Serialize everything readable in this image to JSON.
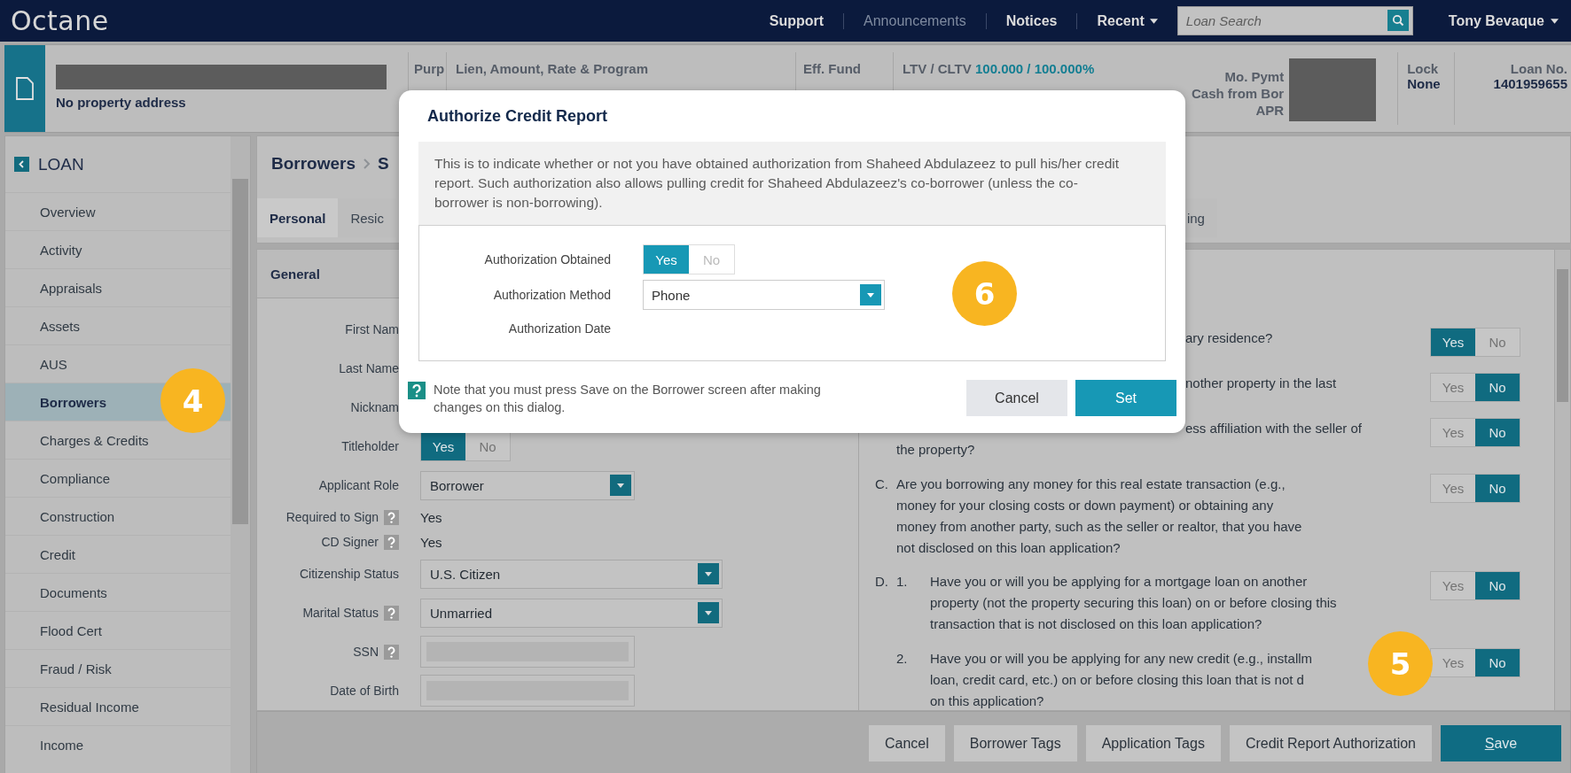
{
  "header": {
    "logo": "Octane",
    "nav": [
      {
        "label": "Support",
        "kind": "link",
        "disabled": false
      },
      {
        "label": "Announcements",
        "kind": "link",
        "disabled": true
      },
      {
        "label": "Notices",
        "kind": "link",
        "disabled": false
      },
      {
        "label": "Recent",
        "kind": "menu",
        "disabled": false
      }
    ],
    "search": {
      "placeholder": "Loan Search"
    },
    "user": {
      "name": "Tony Bevaque"
    }
  },
  "loan_bar": {
    "address": "No property address",
    "purpose_label": "Purp",
    "lien_label": "Lien, Amount, Rate & Program",
    "eff_fund_label": "Eff. Fund",
    "ltv_label": "LTV / CLTV",
    "ltv_value": "100.000 / 100.000%",
    "payment_labels": [
      "Mo. Pymt",
      "Cash from Bor",
      "APR"
    ],
    "lock_label": "Lock",
    "lock_value": "None",
    "loan_no_label": "Loan No.",
    "loan_no_value": "1401959655"
  },
  "sidebar": {
    "title": "LOAN",
    "callout": "4",
    "items": [
      {
        "label": "Overview",
        "selected": false
      },
      {
        "label": "Activity",
        "selected": false
      },
      {
        "label": "Appraisals",
        "selected": false
      },
      {
        "label": "Assets",
        "selected": false
      },
      {
        "label": "AUS",
        "selected": false
      },
      {
        "label": "Borrowers",
        "selected": true
      },
      {
        "label": "Charges & Credits",
        "selected": false
      },
      {
        "label": "Compliance",
        "selected": false
      },
      {
        "label": "Construction",
        "selected": false
      },
      {
        "label": "Credit",
        "selected": false
      },
      {
        "label": "Documents",
        "selected": false
      },
      {
        "label": "Flood Cert",
        "selected": false
      },
      {
        "label": "Fraud / Risk",
        "selected": false
      },
      {
        "label": "Residual Income",
        "selected": false
      },
      {
        "label": "Income",
        "selected": false
      }
    ]
  },
  "page": {
    "breadcrumb": [
      "Borrowers",
      "S"
    ],
    "tabs": [
      {
        "label": "Personal",
        "selected": true
      },
      {
        "label": "Resic",
        "selected": false
      },
      {
        "label": "ing",
        "selected": false
      }
    ]
  },
  "general": {
    "title": "General",
    "fields": [
      {
        "kind": "label",
        "label": "First Nam"
      },
      {
        "kind": "label",
        "label": "Last Name"
      },
      {
        "kind": "label",
        "label": "Nicknam"
      },
      {
        "kind": "toggle",
        "label": "Titleholder",
        "options": [
          {
            "label": "Yes",
            "selected": true
          },
          {
            "label": "No",
            "selected": false
          }
        ]
      },
      {
        "kind": "select",
        "label": "Applicant Role",
        "value": "Borrower"
      },
      {
        "kind": "text",
        "label": "Required to Sign",
        "help": true,
        "value": "Yes"
      },
      {
        "kind": "text",
        "label": "CD Signer",
        "help": true,
        "value": "Yes"
      },
      {
        "kind": "long-select",
        "label": "Citizenship Status",
        "value": "U.S. Citizen"
      },
      {
        "kind": "long-select",
        "label": "Marital Status",
        "help": true,
        "value": "Unmarried"
      },
      {
        "kind": "masked",
        "label": "SSN",
        "help": true
      },
      {
        "kind": "masked",
        "label": "Date of Birth"
      }
    ]
  },
  "questions": {
    "callout": "5",
    "items": [
      {
        "lines": [
          "ary residence?"
        ],
        "options": [
          {
            "label": "Yes",
            "selected": true
          },
          {
            "label": "No",
            "selected": false
          }
        ]
      },
      {
        "lines": [
          "nother property in the last"
        ],
        "options": [
          {
            "label": "Yes",
            "selected": false
          },
          {
            "label": "No",
            "selected": true
          }
        ]
      },
      {
        "lines": [
          "ess affiliation with the seller of",
          "the property?"
        ],
        "options": [
          {
            "label": "Yes",
            "selected": false
          },
          {
            "label": "No",
            "selected": true
          }
        ]
      },
      {
        "letter": "C.",
        "lines": [
          "Are you borrowing any money for this real estate transaction (e.g.,",
          "money for your closing costs or down payment) or obtaining any",
          "money from another party, such as the seller or realtor, that you have",
          "not disclosed on this loan application?"
        ],
        "options": [
          {
            "label": "Yes",
            "selected": false
          },
          {
            "label": "No",
            "selected": true
          }
        ]
      },
      {
        "letter": "D.",
        "number": "1.",
        "lines": [
          "Have you or will you be applying for a mortgage loan on another",
          "property (not the property securing this loan) on or before closing this",
          "transaction that is not disclosed on this loan application?"
        ],
        "options": [
          {
            "label": "Yes",
            "selected": false
          },
          {
            "label": "No",
            "selected": true
          }
        ]
      },
      {
        "number": "2.",
        "lines": [
          "Have you or will you be applying for any new credit (e.g., installm",
          "loan, credit card, etc.) on or before closing this loan that is not d",
          "on this application?"
        ],
        "options": [
          {
            "label": "Yes",
            "selected": false
          },
          {
            "label": "No",
            "selected": true
          }
        ]
      }
    ]
  },
  "footer_buttons": [
    {
      "label": "Cancel",
      "primary": false
    },
    {
      "label": "Borrower Tags",
      "primary": false
    },
    {
      "label": "Application Tags",
      "primary": false
    },
    {
      "label": "Credit Report Authorization",
      "primary": false
    },
    {
      "label": "Save",
      "primary": true
    }
  ],
  "dialog": {
    "title": "Authorize Credit Report",
    "callout": "6",
    "info": "This is to indicate whether or not you have obtained authorization from Shaheed Abdulazeez to pull his/her credit report. Such authorization also allows pulling credit for Shaheed Abdulazeez's co-borrower (unless the co-borrower is non-borrowing).",
    "fields": [
      {
        "kind": "toggle",
        "label": "Authorization Obtained",
        "options": [
          {
            "label": "Yes",
            "selected": true
          },
          {
            "label": "No",
            "selected": false
          }
        ]
      },
      {
        "kind": "select",
        "label": "Authorization Method",
        "value": "Phone"
      },
      {
        "kind": "label",
        "label": "Authorization Date"
      }
    ],
    "note": "Note that you must press Save on the Borrower screen after making changes on this dialog.",
    "buttons": [
      {
        "label": "Cancel",
        "primary": false
      },
      {
        "label": "Set",
        "primary": true
      }
    ]
  }
}
